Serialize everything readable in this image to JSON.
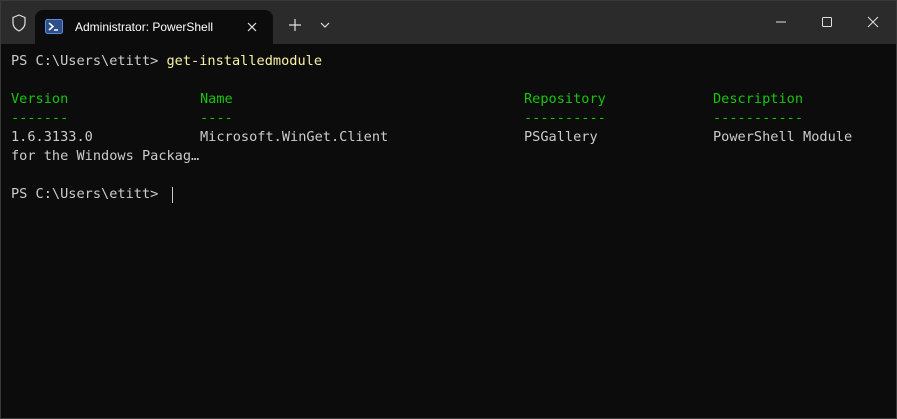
{
  "window": {
    "tab_title": "Administrator: PowerShell"
  },
  "icons": {
    "shield": "shield-icon",
    "powershell": "powershell-icon",
    "tab_close": "close-icon",
    "new_tab": "plus-icon",
    "dropdown": "chevron-down-icon",
    "minimize": "minimize-icon",
    "maximize": "maximize-icon",
    "close": "close-icon"
  },
  "colors": {
    "background": "#0c0c0c",
    "titlebar": "#2b2b2b",
    "text": "#cccccc",
    "command": "#f9f1a5",
    "header": "#16c60c"
  },
  "console": {
    "prompt1": "PS C:\\Users\\etitt> ",
    "command1": "get-installedmodule",
    "headers": [
      "Version",
      "Name",
      "Repository",
      "Description"
    ],
    "underlines": [
      "-------",
      "----",
      "----------",
      "-----------"
    ],
    "row": [
      "1.6.3133.0",
      "Microsoft.WinGet.Client",
      "PSGallery",
      "PowerShell Module"
    ],
    "wrap": "for the Windows Packag…",
    "prompt2": "PS C:\\Users\\etitt> "
  }
}
